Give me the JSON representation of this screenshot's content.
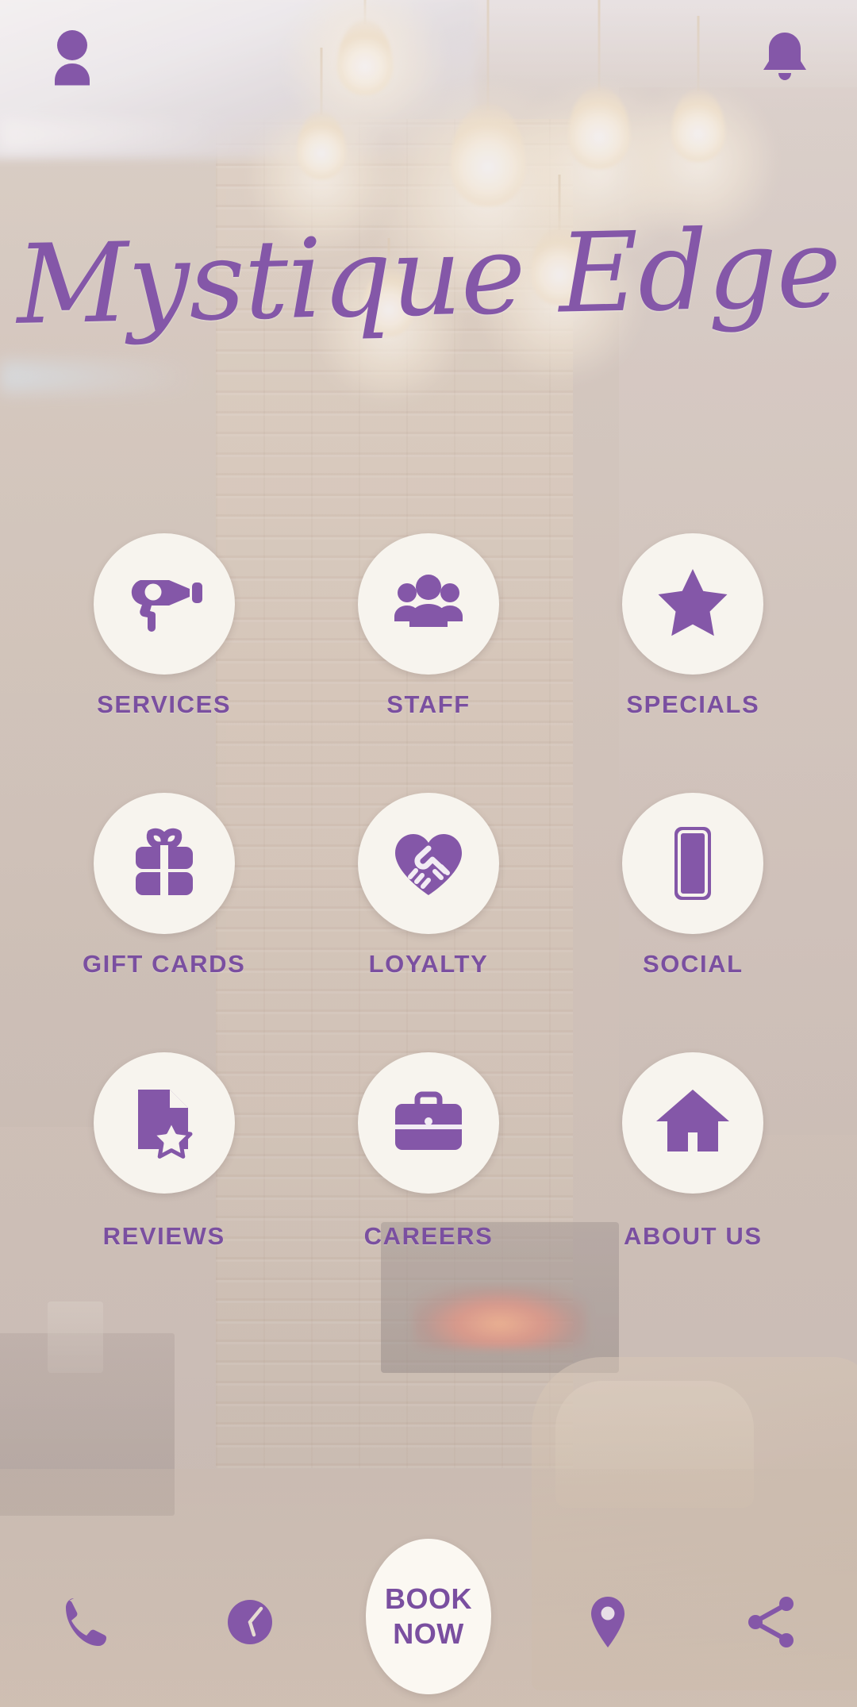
{
  "app": {
    "logo_text": "Mystique Edge",
    "brand_purple": "#7a4fa0",
    "icon_purple": "#8457a8",
    "circle_bg": "#f7f4ee"
  },
  "topbar": {
    "profile_icon": "person-icon",
    "notification_icon": "bell-icon"
  },
  "grid": {
    "items": [
      {
        "label": "SERVICES",
        "icon": "hair-dryer-icon"
      },
      {
        "label": "STAFF",
        "icon": "people-group-icon"
      },
      {
        "label": "SPECIALS",
        "icon": "star-icon"
      },
      {
        "label": "GIFT CARDS",
        "icon": "gift-box-icon"
      },
      {
        "label": "LOYALTY",
        "icon": "heart-handshake-icon"
      },
      {
        "label": "SOCIAL",
        "icon": "mobile-phone-icon"
      },
      {
        "label": "REVIEWS",
        "icon": "document-star-icon"
      },
      {
        "label": "CAREERS",
        "icon": "briefcase-icon"
      },
      {
        "label": "ABOUT US",
        "icon": "home-icon"
      }
    ]
  },
  "bottombar": {
    "call_icon": "phone-icon",
    "hours_icon": "clock-icon",
    "book_now_line1": "BOOK",
    "book_now_line2": "NOW",
    "location_icon": "map-pin-icon",
    "share_icon": "share-icon"
  }
}
